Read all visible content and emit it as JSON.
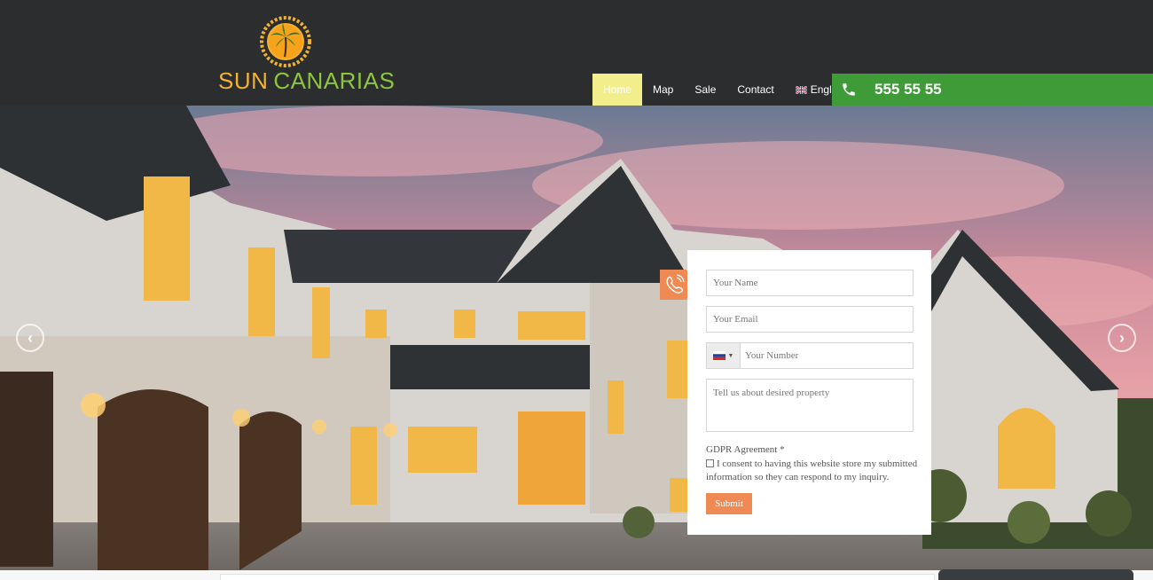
{
  "brand": {
    "name_part1": "SUN",
    "name_part2": "CANARIAS",
    "colors": {
      "sun": "#f2b233",
      "palm": "#8cc63f",
      "header_bg": "#2b2d2f"
    }
  },
  "nav": {
    "items": [
      {
        "label": "Home",
        "active": true
      },
      {
        "label": "Map",
        "active": false
      },
      {
        "label": "Sale",
        "active": false
      },
      {
        "label": "Contact",
        "active": false
      },
      {
        "label": "English",
        "active": false,
        "icon": "uk-flag-icon"
      }
    ]
  },
  "phone": {
    "number": "555 55 55",
    "icon": "phone-icon",
    "bg": "#3f9a38"
  },
  "slider": {
    "prev_icon": "chevron-left-icon",
    "next_icon": "chevron-right-icon",
    "prev_glyph": "‹",
    "next_glyph": "›"
  },
  "form": {
    "name_placeholder": "Your Name",
    "email_placeholder": "Your Email",
    "number_placeholder": "Your Number",
    "country_flag": "russia-flag-icon",
    "message_placeholder": "Tell us about desired property",
    "gdpr_title": "GDPR Agreement *",
    "consent_text": "I consent to having this website store my submitted information so they can respond to my inquiry.",
    "submit_label": "Submit",
    "accent": "#ef8a55"
  }
}
